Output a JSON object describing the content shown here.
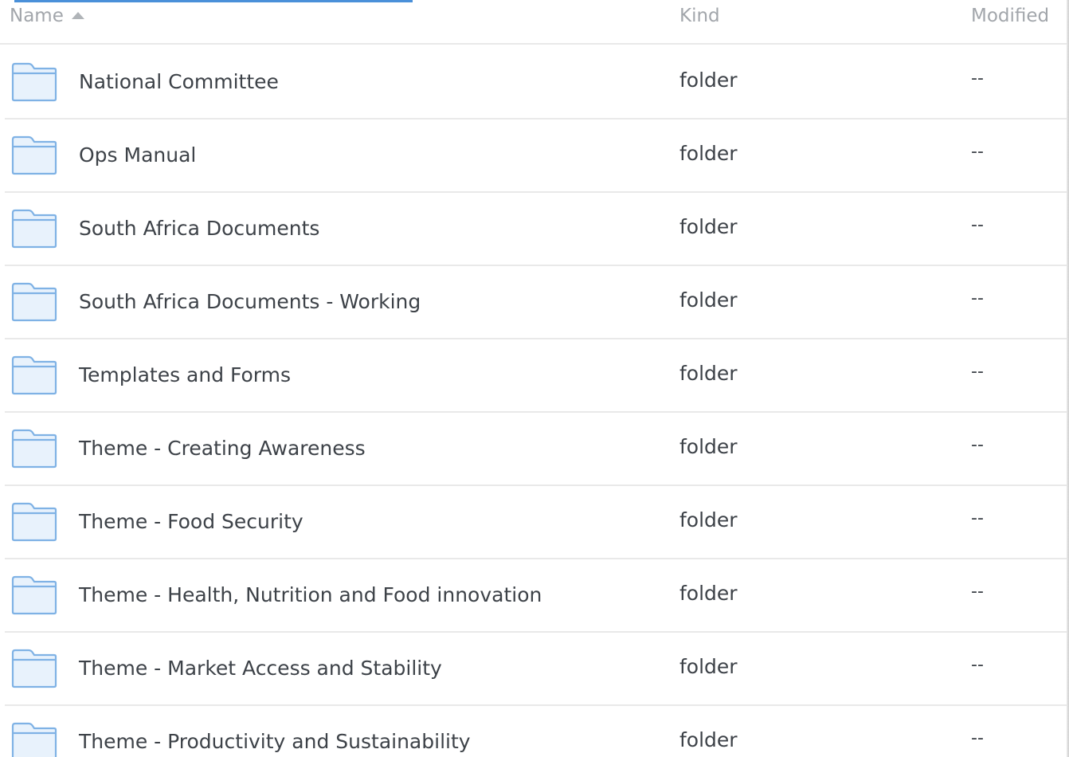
{
  "columns": {
    "name": "Name",
    "kind": "Kind",
    "modified": "Modified"
  },
  "sort": {
    "column": "name",
    "direction": "ascending",
    "icon": "sort-ascending-icon"
  },
  "colors": {
    "folder_fill": "#e8f2fc",
    "folder_stroke": "#7fb2e5",
    "text": "#3d4248",
    "header_text": "#a2a6ab",
    "divider": "#e9e9e9",
    "accent": "#4a90d9"
  },
  "rows": [
    {
      "name": "National Committee",
      "kind": "folder",
      "modified": "--",
      "icon": "folder-icon"
    },
    {
      "name": "Ops Manual",
      "kind": "folder",
      "modified": "--",
      "icon": "folder-icon"
    },
    {
      "name": "South Africa Documents",
      "kind": "folder",
      "modified": "--",
      "icon": "folder-icon"
    },
    {
      "name": "South Africa Documents - Working",
      "kind": "folder",
      "modified": "--",
      "icon": "folder-icon"
    },
    {
      "name": "Templates and Forms",
      "kind": "folder",
      "modified": "--",
      "icon": "folder-icon"
    },
    {
      "name": "Theme - Creating Awareness",
      "kind": "folder",
      "modified": "--",
      "icon": "folder-icon"
    },
    {
      "name": "Theme - Food Security",
      "kind": "folder",
      "modified": "--",
      "icon": "folder-icon"
    },
    {
      "name": "Theme - Health, Nutrition and Food innovation",
      "kind": "folder",
      "modified": "--",
      "icon": "folder-icon"
    },
    {
      "name": "Theme - Market Access and Stability",
      "kind": "folder",
      "modified": "--",
      "icon": "folder-icon"
    },
    {
      "name": "Theme - Productivity and Sustainability",
      "kind": "folder",
      "modified": "--",
      "icon": "folder-icon"
    }
  ]
}
